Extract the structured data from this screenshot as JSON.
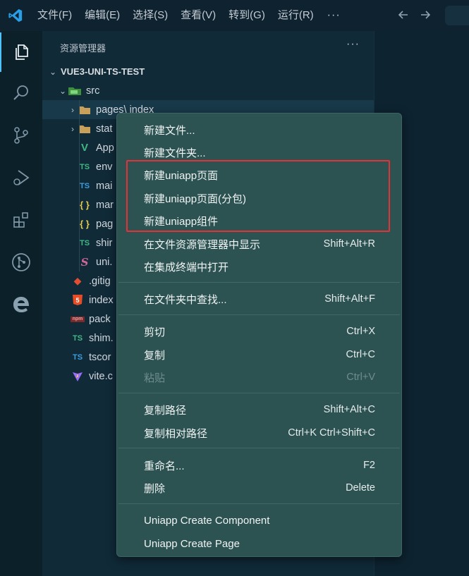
{
  "titlebar": {
    "menus": [
      "文件(F)",
      "编辑(E)",
      "选择(S)",
      "查看(V)",
      "转到(G)",
      "运行(R)"
    ],
    "more": "···",
    "back_icon": "arrow-left-icon",
    "forward_icon": "arrow-right-icon"
  },
  "activitybar": {
    "items": [
      "files-icon",
      "search-icon",
      "source-control-icon",
      "run-debug-icon",
      "extensions-icon",
      "git-graph-icon",
      "edge-icon"
    ]
  },
  "sidebar": {
    "title": "资源管理器",
    "more": "···",
    "root": "VUE3-UNI-TS-TEST",
    "tree": [
      {
        "label": "src",
        "icon": "folder-src-icon"
      },
      {
        "label": "pages\\ index",
        "icon": "folder-icon"
      },
      {
        "label": "stat",
        "icon": "folder-icon"
      },
      {
        "label": "App",
        "icon": "vue-icon",
        "glyph": "V"
      },
      {
        "label": "env",
        "icon": "typescript-icon",
        "glyph": "TS"
      },
      {
        "label": "mai",
        "icon": "typescript-icon",
        "glyph": "TS"
      },
      {
        "label": "mar",
        "icon": "json-icon",
        "glyph": "{ }"
      },
      {
        "label": "pag",
        "icon": "json-icon",
        "glyph": "{ }"
      },
      {
        "label": "shir",
        "icon": "typescript-icon",
        "glyph": "TS"
      },
      {
        "label": "uni.",
        "icon": "sass-icon",
        "glyph": "S"
      },
      {
        "label": ".gitig",
        "icon": "git-icon",
        "glyph": "◆"
      },
      {
        "label": "index",
        "icon": "html-icon",
        "glyph": "5"
      },
      {
        "label": "pack",
        "icon": "npm-icon",
        "glyph": "npm"
      },
      {
        "label": "shim.",
        "icon": "typescript-icon",
        "glyph": "TS"
      },
      {
        "label": "tscor",
        "icon": "tsconfig-icon",
        "glyph": "TS"
      },
      {
        "label": "vite.c",
        "icon": "vite-icon",
        "glyph": "▼"
      }
    ]
  },
  "context_menu": {
    "items": [
      {
        "label": "新建文件...",
        "shortcut": ""
      },
      {
        "label": "新建文件夹...",
        "shortcut": ""
      },
      {
        "label": "新建uniapp页面",
        "shortcut": ""
      },
      {
        "label": "新建uniapp页面(分包)",
        "shortcut": ""
      },
      {
        "label": "新建uniapp组件",
        "shortcut": ""
      },
      {
        "label": "在文件资源管理器中显示",
        "shortcut": "Shift+Alt+R"
      },
      {
        "label": "在集成终端中打开",
        "shortcut": ""
      },
      {
        "label": "在文件夹中查找...",
        "shortcut": "Shift+Alt+F"
      },
      {
        "label": "剪切",
        "shortcut": "Ctrl+X"
      },
      {
        "label": "复制",
        "shortcut": "Ctrl+C"
      },
      {
        "label": "粘贴",
        "shortcut": "Ctrl+V",
        "disabled": true
      },
      {
        "label": "复制路径",
        "shortcut": "Shift+Alt+C"
      },
      {
        "label": "复制相对路径",
        "shortcut": "Ctrl+K Ctrl+Shift+C"
      },
      {
        "label": "重命名...",
        "shortcut": "F2"
      },
      {
        "label": "删除",
        "shortcut": "Delete"
      },
      {
        "label": "Uniapp Create Component",
        "shortcut": ""
      },
      {
        "label": "Uniapp Create Page",
        "shortcut": ""
      }
    ]
  },
  "colors": {
    "accent": "#4fc1ff",
    "highlight_box": "#e53239",
    "menu_bg": "#2c5252",
    "typescript": "#3b9ede",
    "vue": "#41b883",
    "json": "#e6c84a"
  }
}
